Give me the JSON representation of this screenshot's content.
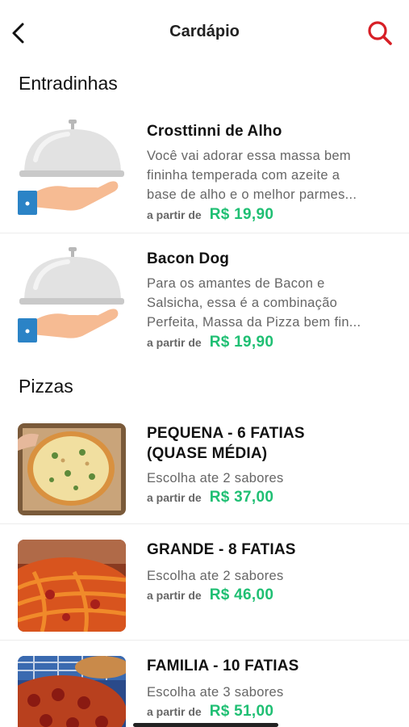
{
  "header": {
    "title": "Cardápio",
    "back_icon": "chevron-left-icon",
    "search_icon": "search-icon",
    "accent": "#d71f26"
  },
  "sections": [
    {
      "title": "Entradinhas",
      "items": [
        {
          "name": "Crosttinni de Alho",
          "desc_lines": [
            "Você vai adorar essa massa bem",
            "fininha temperada com azeite a",
            "base de alho  e o melhor parmes..."
          ],
          "from": "a partir de",
          "price": "R$ 19,90",
          "image": "cloche-serving-icon"
        },
        {
          "name": "Bacon Dog",
          "desc_lines": [
            "Para os amantes de Bacon e",
            "Salsicha, essa é a combinação",
            "Perfeita, Massa da Pizza bem fin..."
          ],
          "from": "a partir de",
          "price": "R$ 19,90",
          "image": "cloche-serving-icon"
        }
      ]
    },
    {
      "title": "Pizzas",
      "items": [
        {
          "name_lines": [
            "PEQUENA - 6 FATIAS",
            "(QUASE MÉDIA)"
          ],
          "desc": "Escolha ate 2 sabores",
          "from": "a partir de",
          "price": "R$ 37,00",
          "image": "pizza-photo"
        },
        {
          "name": "GRANDE - 8 FATIAS",
          "desc": "Escolha ate 2 sabores",
          "from": "a partir de",
          "price": "R$ 46,00",
          "image": "pizza-photo"
        },
        {
          "name": "FAMILIA - 10 FATIAS",
          "desc": "Escolha ate 3 sabores",
          "from": "a partir de",
          "price": "R$ 51,00",
          "image": "pizza-photo"
        }
      ]
    }
  ],
  "colors": {
    "price": "#1fbf73",
    "muted_text": "#666666"
  }
}
